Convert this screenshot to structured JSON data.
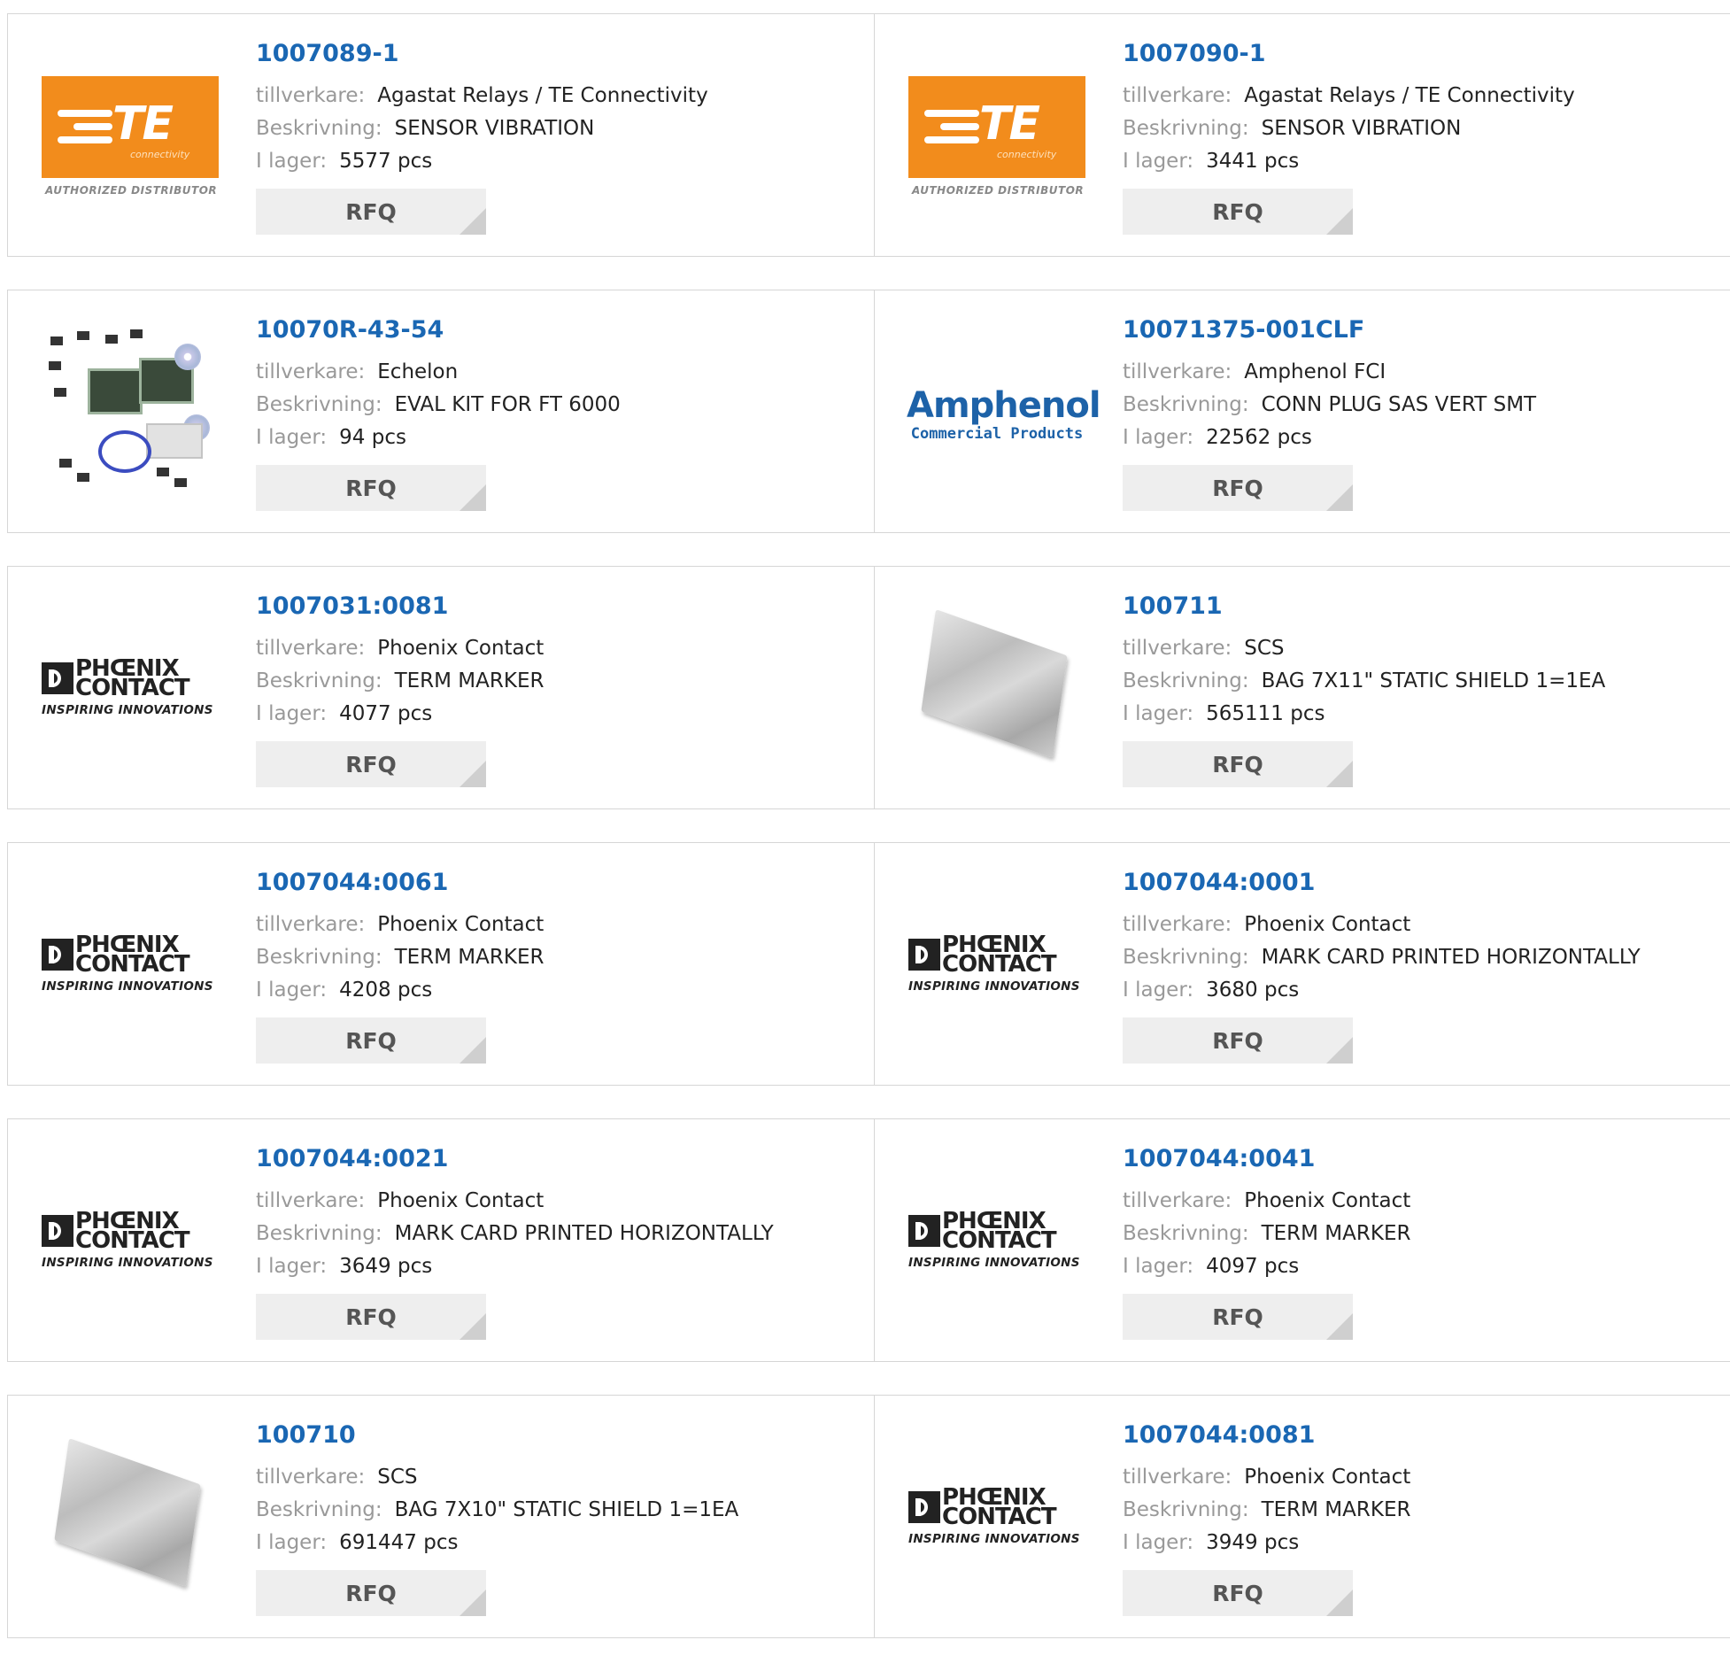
{
  "labels": {
    "manufacturer": "tillverkare:",
    "description": "Beskrivning:",
    "stock": "I lager:",
    "rfq": "RFQ"
  },
  "logos": {
    "te_word": "TE",
    "te_sub": "connectivity",
    "te_auth": "AUTHORIZED DISTRIBUTOR",
    "phoenix_1": "PHŒNIX",
    "phoenix_2": "CONTACT",
    "phoenix_tag": "INSPIRING INNOVATIONS",
    "amphenol_1": "Amphenol",
    "amphenol_2": "Commercial Products"
  },
  "products": [
    {
      "part": "1007089-1",
      "manufacturer": "Agastat Relays / TE Connectivity",
      "description": "SENSOR VIBRATION",
      "stock": "5577 pcs",
      "logo": "te-logo"
    },
    {
      "part": "1007090-1",
      "manufacturer": "Agastat Relays / TE Connectivity",
      "description": "SENSOR VIBRATION",
      "stock": "3441 pcs",
      "logo": "te-logo"
    },
    {
      "part": "10070R-43-54",
      "manufacturer": "Echelon",
      "description": "EVAL KIT FOR FT 6000",
      "stock": "94 pcs",
      "logo": "eval-kit-image"
    },
    {
      "part": "10071375-001CLF",
      "manufacturer": "Amphenol FCI",
      "description": "CONN PLUG SAS VERT SMT",
      "stock": "22562 pcs",
      "logo": "amphenol-logo"
    },
    {
      "part": "1007031:0081",
      "manufacturer": "Phoenix Contact",
      "description": "TERM MARKER",
      "stock": "4077 pcs",
      "logo": "phoenix-logo"
    },
    {
      "part": "100711",
      "manufacturer": "SCS",
      "description": "BAG 7X11\" STATIC SHIELD 1=1EA",
      "stock": "565111 pcs",
      "logo": "static-bag-image"
    },
    {
      "part": "1007044:0061",
      "manufacturer": "Phoenix Contact",
      "description": "TERM MARKER",
      "stock": "4208 pcs",
      "logo": "phoenix-logo"
    },
    {
      "part": "1007044:0001",
      "manufacturer": "Phoenix Contact",
      "description": "MARK CARD PRINTED HORIZONTALLY",
      "stock": "3680 pcs",
      "logo": "phoenix-logo"
    },
    {
      "part": "1007044:0021",
      "manufacturer": "Phoenix Contact",
      "description": "MARK CARD PRINTED HORIZONTALLY",
      "stock": "3649 pcs",
      "logo": "phoenix-logo"
    },
    {
      "part": "1007044:0041",
      "manufacturer": "Phoenix Contact",
      "description": "TERM MARKER",
      "stock": "4097 pcs",
      "logo": "phoenix-logo"
    },
    {
      "part": "100710",
      "manufacturer": "SCS",
      "description": "BAG 7X10\" STATIC SHIELD 1=1EA",
      "stock": "691447 pcs",
      "logo": "static-bag-image"
    },
    {
      "part": "1007044:0081",
      "manufacturer": "Phoenix Contact",
      "description": "TERM MARKER",
      "stock": "3949 pcs",
      "logo": "phoenix-logo"
    }
  ],
  "colors": {
    "link": "#1a67b3",
    "label": "#999999",
    "te_orange": "#f28c1c",
    "amphenol_blue": "#1d62a8",
    "rfq_bg": "#eeeeee"
  }
}
